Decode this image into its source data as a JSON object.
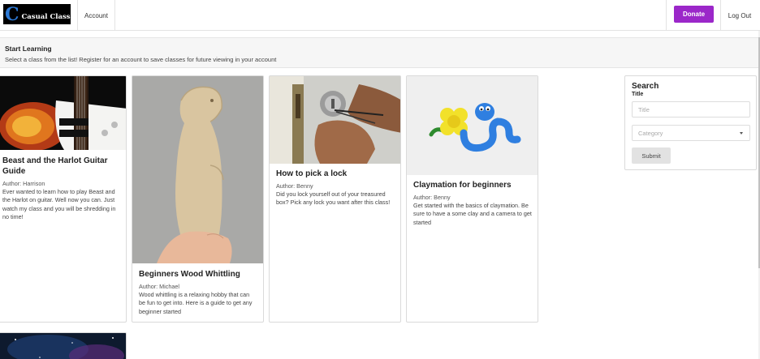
{
  "navbar": {
    "logo_letter": "C",
    "logo_text": "Casual Class",
    "account_label": "Account",
    "donate_label": "Donate",
    "logout_label": "Log Out"
  },
  "banner": {
    "title": "Start Learning",
    "subtitle": "Select a class from the list! Register for an account to save classes for future viewing in your account"
  },
  "classes": [
    {
      "title": "Beast and the Harlot Guitar Guide",
      "author": "Author: Harrison",
      "description": "Ever wanted to learn how to play Beast and the Harlot on guitar. Well now you can. Just watch my class and you will be shredding in no time!",
      "image": "electric-guitar"
    },
    {
      "title": "Beginners Wood Whittling",
      "author": "Author: Michael",
      "description": "Wood whittling is a relaxing hobby that can be fun to get into. Here is a guide to get any beginner started",
      "image": "wood-carving"
    },
    {
      "title": "How to pick a lock",
      "author": "Author: Benny",
      "description": "Did you lock yourself out of your treasured box? Pick any lock you want after this class!",
      "image": "lock-picking"
    },
    {
      "title": "Claymation for beginners",
      "author": "Author: Benny",
      "description": "Get started with the basics of claymation. Be sure to have a some clay and a camera to get started",
      "image": "clay-figures"
    },
    {
      "title": "",
      "author": "",
      "description": "",
      "image": "space-nebula"
    }
  ],
  "search": {
    "heading": "Search",
    "title_label": "Title",
    "title_placeholder": "Title",
    "category_placeholder": "Category",
    "submit_label": "Submit"
  },
  "colors": {
    "donate": "#9b27c9",
    "logo_accent": "#2d7ad6",
    "banner_bg": "#f6f6f6"
  }
}
